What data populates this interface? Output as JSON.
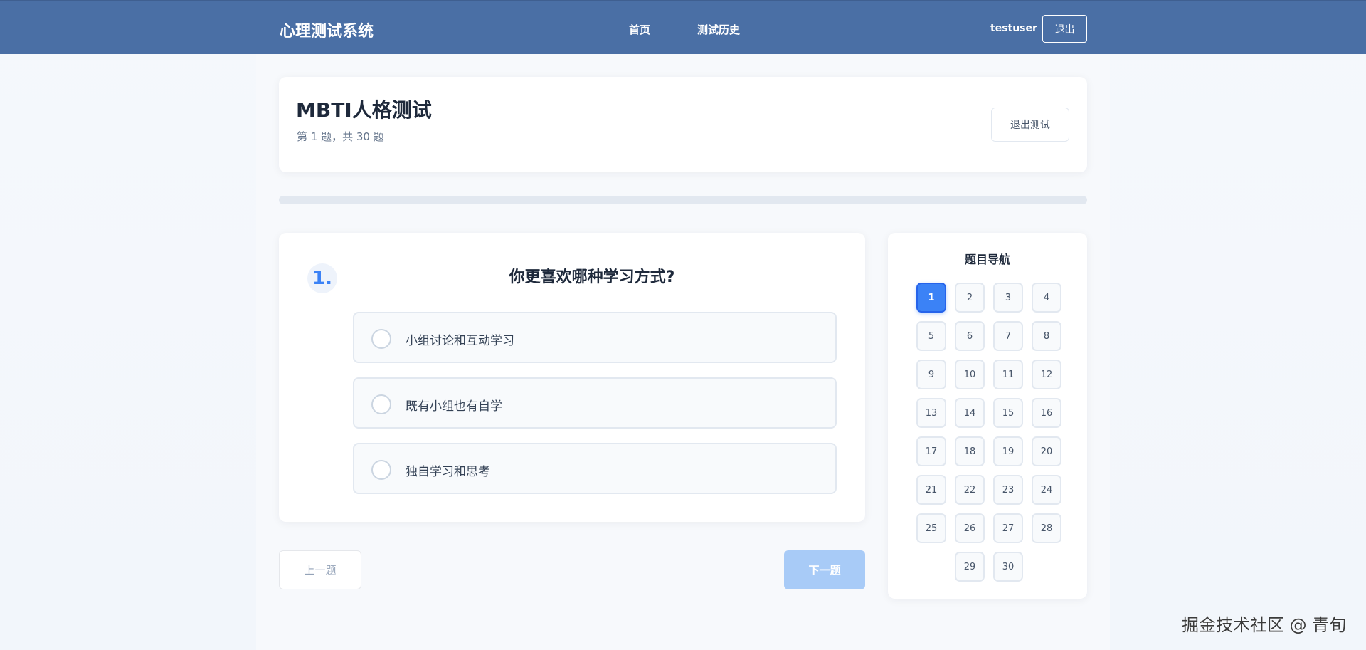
{
  "header": {
    "brand": "心理测试系统",
    "nav": [
      {
        "label": "首页"
      },
      {
        "label": "测试历史"
      }
    ],
    "username": "testuser",
    "logout_label": "退出"
  },
  "test": {
    "title": "MBTI人格测试",
    "progress_text": "第 1 题，共 30 题",
    "exit_label": "退出测试",
    "progress_fraction": 0
  },
  "question": {
    "number": "1.",
    "text": "你更喜欢哪种学习方式?",
    "options": [
      {
        "label": "小组讨论和互动学习"
      },
      {
        "label": "既有小组也有自学"
      },
      {
        "label": "独自学习和思考"
      }
    ]
  },
  "footer": {
    "prev_label": "上一题",
    "next_label": "下一题"
  },
  "navigator": {
    "title": "题目导航",
    "current": 1,
    "items": [
      "1",
      "2",
      "3",
      "4",
      "5",
      "6",
      "7",
      "8",
      "9",
      "10",
      "11",
      "12",
      "13",
      "14",
      "15",
      "16",
      "17",
      "18",
      "19",
      "20",
      "21",
      "22",
      "23",
      "24",
      "25",
      "26",
      "27",
      "28",
      "29",
      "30"
    ]
  },
  "watermark": "掘金技术社区 @ 青旬",
  "colors": {
    "header_bg": "#4a6fa5",
    "accent": "#3b82f6",
    "next_disabled": "#a8cbf7"
  }
}
